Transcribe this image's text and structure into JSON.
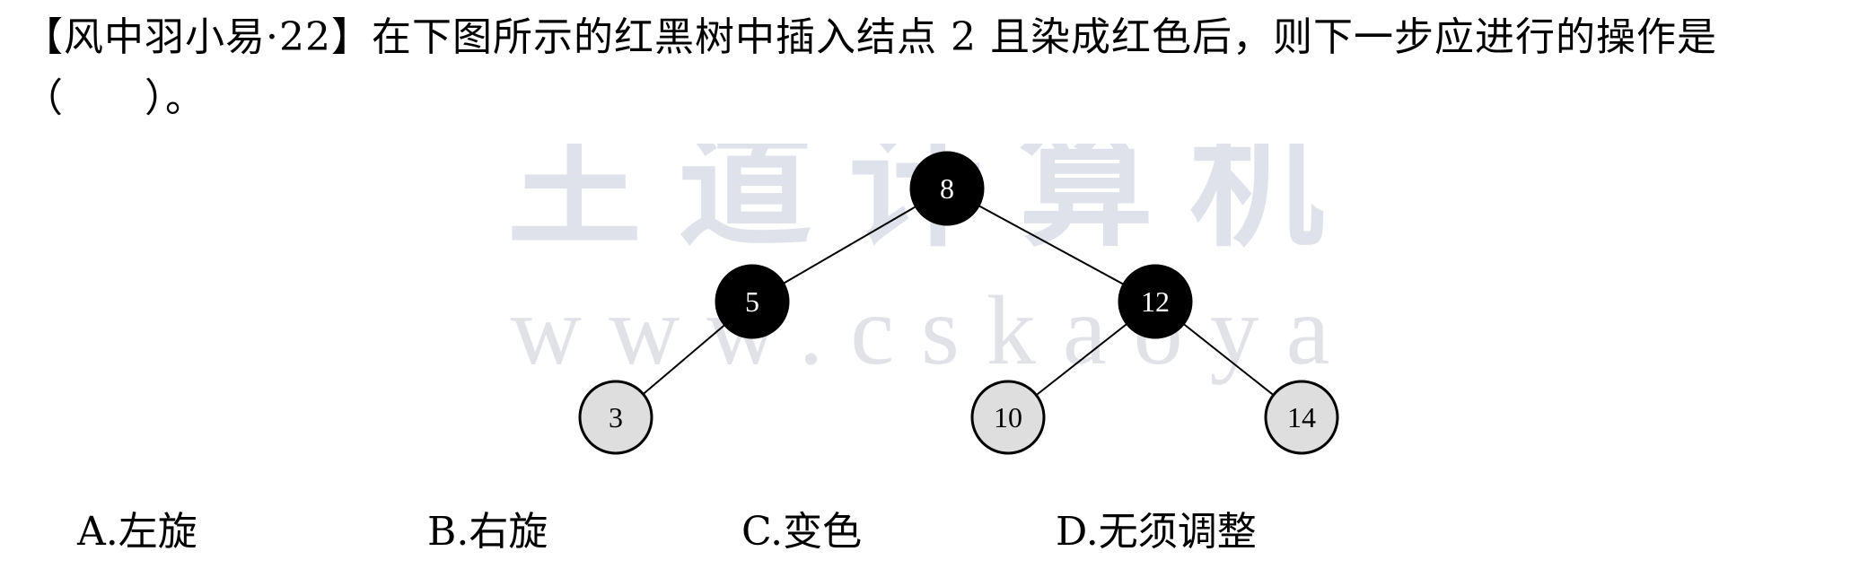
{
  "question": {
    "source": "【风中羽小易·22】",
    "text": "在下图所示的红黑树中插入结点 2 且染成红色后，则下一步应进行的操作是（　　）。"
  },
  "watermark": {
    "text": "www.cskaoya",
    "brand": "王道计算机"
  },
  "tree": {
    "nodes": [
      {
        "id": "n8",
        "label": "8",
        "color": "black",
        "level": 0
      },
      {
        "id": "n5",
        "label": "5",
        "color": "black",
        "level": 1
      },
      {
        "id": "n12",
        "label": "12",
        "color": "black",
        "level": 1
      },
      {
        "id": "n3",
        "label": "3",
        "color": "red",
        "level": 2
      },
      {
        "id": "n10",
        "label": "10",
        "color": "red",
        "level": 2
      },
      {
        "id": "n14",
        "label": "14",
        "color": "red",
        "level": 2
      }
    ],
    "edges": [
      [
        "n8",
        "n5"
      ],
      [
        "n8",
        "n12"
      ],
      [
        "n5",
        "n3"
      ],
      [
        "n12",
        "n10"
      ],
      [
        "n12",
        "n14"
      ]
    ],
    "colors": {
      "black_fill": "#000000",
      "red_fill": "#dedede",
      "stroke": "#000000",
      "black_text": "#ffffff",
      "red_text": "#000000",
      "watermark": "#c5ccdc"
    }
  },
  "options": [
    {
      "key": "A",
      "label": "A.左旋"
    },
    {
      "key": "B",
      "label": "B.右旋"
    },
    {
      "key": "C",
      "label": "C.变色"
    },
    {
      "key": "D",
      "label": "D.无须调整"
    }
  ]
}
